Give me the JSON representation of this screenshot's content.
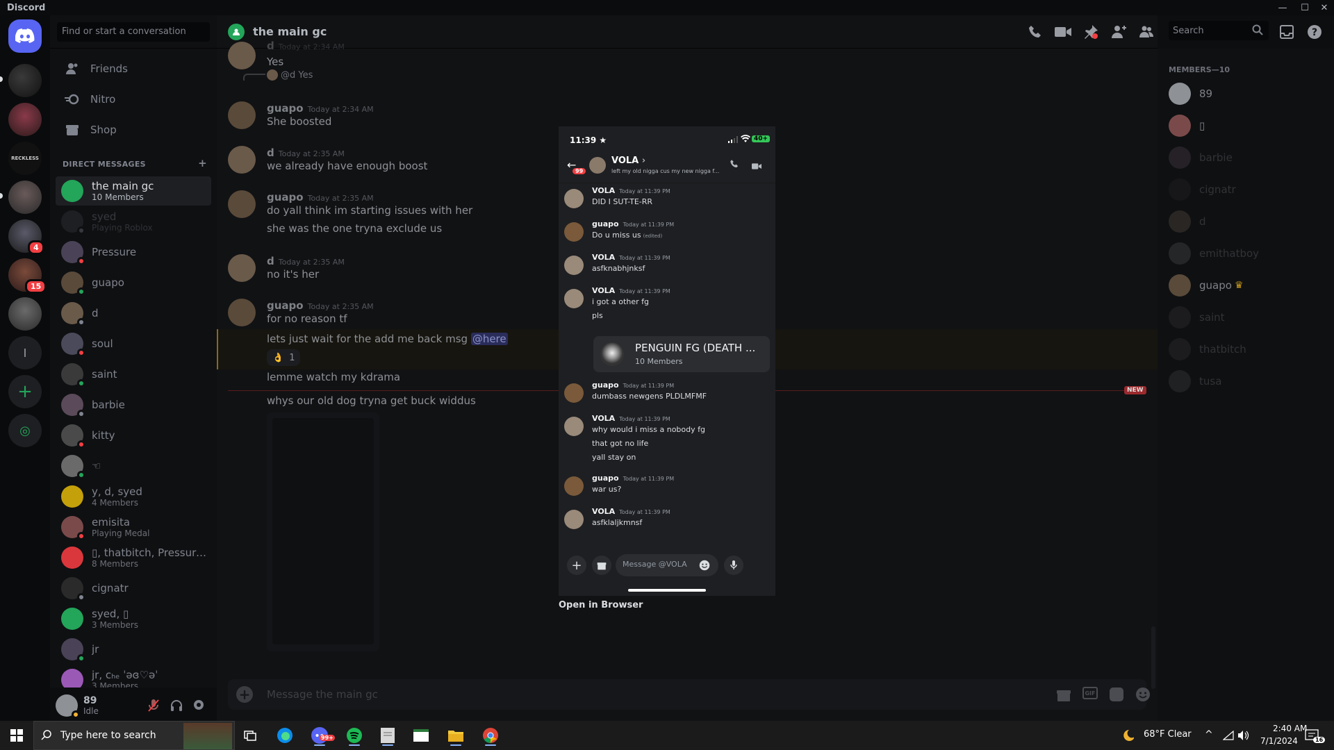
{
  "app": {
    "title": "Discord"
  },
  "dm_sidebar": {
    "search_placeholder": "Find or start a conversation",
    "nav": [
      {
        "label": "Friends",
        "icon": "friends-icon"
      },
      {
        "label": "Nitro",
        "icon": "nitro-icon"
      },
      {
        "label": "Shop",
        "icon": "shop-icon"
      }
    ],
    "dm_header": "DIRECT MESSAGES",
    "add_label": "+",
    "dms": [
      {
        "name": "the main gc",
        "sub": "10 Members",
        "color": "#23a55a",
        "selected": true
      },
      {
        "name": "syed",
        "sub": "Playing Roblox",
        "color": "#3a3d44",
        "faded": true
      },
      {
        "name": "Pressure",
        "sub": "",
        "color": "#4a4256"
      },
      {
        "name": "guapo",
        "sub": "",
        "color": "#5a4a3a"
      },
      {
        "name": "d",
        "sub": "",
        "color": "#6a5a4a"
      },
      {
        "name": "soul",
        "sub": "",
        "color": "#4a4a5a"
      },
      {
        "name": "saint",
        "sub": "",
        "color": "#3a3a3a"
      },
      {
        "name": "barbie",
        "sub": "",
        "color": "#5a4a5a"
      },
      {
        "name": "kitty",
        "sub": "",
        "color": "#4a4a4a"
      },
      {
        "name": "☜",
        "sub": "",
        "color": "#6a6a6a"
      },
      {
        "name": "y, d, syed",
        "sub": "4 Members",
        "color": "#c4a00a"
      },
      {
        "name": "emisita",
        "sub": "Playing Medal",
        "color": "#7a4a4a"
      },
      {
        "name": "▯, thatbitch, Pressure...",
        "sub": "8 Members",
        "color": "#da373c"
      },
      {
        "name": "cignatr",
        "sub": "",
        "color": "#2a2a2a"
      },
      {
        "name": "syed, ▯",
        "sub": "3 Members",
        "color": "#23a55a"
      },
      {
        "name": "jr",
        "sub": "",
        "color": "#4a4256"
      },
      {
        "name": "jr, ᴄₕₑ ˈəɞ♡əˈ",
        "sub": "3 Members",
        "color": "#9b59b6"
      }
    ]
  },
  "user_panel": {
    "name": "89",
    "status": "Idle"
  },
  "chat": {
    "channel": "the main gc",
    "search_placeholder": "Search",
    "messages": [
      {
        "type": "cont",
        "text": "Yes",
        "author": "d",
        "time": "Today at 2:34 AM"
      },
      {
        "type": "reply",
        "reply": "@d Yes"
      },
      {
        "type": "full",
        "author": "guapo",
        "time": "Today at 2:34 AM",
        "lines": [
          "She boosted"
        ]
      },
      {
        "type": "full",
        "author": "d",
        "time": "Today at 2:35 AM",
        "lines": [
          "we already have enough boost"
        ]
      },
      {
        "type": "full",
        "author": "guapo",
        "time": "Today at 2:35 AM",
        "lines": [
          "do yall think im starting issues with her",
          "she was the one tryna exclude us"
        ]
      },
      {
        "type": "full",
        "author": "d",
        "time": "Today at 2:35 AM",
        "lines": [
          "no it's her"
        ]
      },
      {
        "type": "full",
        "author": "guapo",
        "time": "Today at 2:35 AM",
        "lines": [
          "for no reason tf"
        ]
      }
    ],
    "mention_msg": "lets just wait for the add me back msg",
    "mention": "@here",
    "reaction_count": "1",
    "kdrama": "lemme watch my kdrama",
    "new_label": "NEW",
    "dog": "whys our old dog tryna get buck widdus",
    "input_placeholder": "Message the main gc",
    "gif_label": "GIF"
  },
  "members": {
    "header": "MEMBERS—10",
    "list": [
      {
        "name": "89",
        "color": "#8e9297"
      },
      {
        "name": "▯",
        "color": "#7a4a4a"
      },
      {
        "name": "barbie",
        "color": "#5a4a5a",
        "faded": true
      },
      {
        "name": "cignatr",
        "color": "#2a2a2a",
        "faded": true
      },
      {
        "name": "d",
        "color": "#6a5a4a",
        "faded": true
      },
      {
        "name": "emithatboy",
        "color": "#5a5a5a",
        "faded": true
      },
      {
        "name": "guapo",
        "color": "#5a4a3a",
        "crown": "♛"
      },
      {
        "name": "saint",
        "color": "#3a3a3a",
        "faded": true
      },
      {
        "name": "thatbitch",
        "color": "#3a3a3a",
        "faded": true
      },
      {
        "name": "tusa",
        "color": "#4a4a4a",
        "faded": true
      }
    ]
  },
  "phone": {
    "time": "11:39 ★",
    "battery": "40+",
    "unread": "99",
    "contact": "VOLA",
    "chevron": "›",
    "status": "left my old nigga cus my new nigga f...",
    "messages": [
      {
        "name": "VOLA",
        "time": "Today at 11:39 PM",
        "lines": [
          "DID I SUT-TE-RR"
        ]
      },
      {
        "name": "guapo",
        "time": "Today at 11:39 PM",
        "lines": [
          "Do u miss us"
        ],
        "edited": "(edited)"
      },
      {
        "name": "VOLA",
        "time": "Today at 11:39 PM",
        "lines": [
          "asfknabhjnksf"
        ]
      },
      {
        "name": "VOLA",
        "time": "Today at 11:39 PM",
        "lines": [
          "i got a other fg",
          "pls"
        ]
      },
      {
        "name": "guapo",
        "time": "Today at 11:39 PM",
        "lines": [
          "dumbass newgens PLDLMFMF"
        ]
      },
      {
        "name": "VOLA",
        "time": "Today at 11:39 PM",
        "lines": [
          "why would i miss a nobody fg",
          "that got no life",
          "yall stay on"
        ]
      },
      {
        "name": "guapo",
        "time": "Today at 11:39 PM",
        "lines": [
          "war us?"
        ]
      },
      {
        "name": "VOLA",
        "time": "Today at 11:39 PM",
        "lines": [
          "asfklaljkmnsf"
        ]
      }
    ],
    "invite": {
      "title": "PENGUIN FG (DEATH ...",
      "members": "10 Members"
    },
    "input_placeholder": "Message @VOLA"
  },
  "open_in_browser": "Open in Browser",
  "taskbar": {
    "search": "Type here to search",
    "weather": "68°F  Clear",
    "time": "2:40 AM",
    "date": "7/1/2024",
    "discord_badge": "99+",
    "notif": "16"
  },
  "colors": {
    "accent": "#5865f2",
    "online": "#23a55a",
    "dnd": "#f23f43",
    "idle": "#f0b232"
  }
}
